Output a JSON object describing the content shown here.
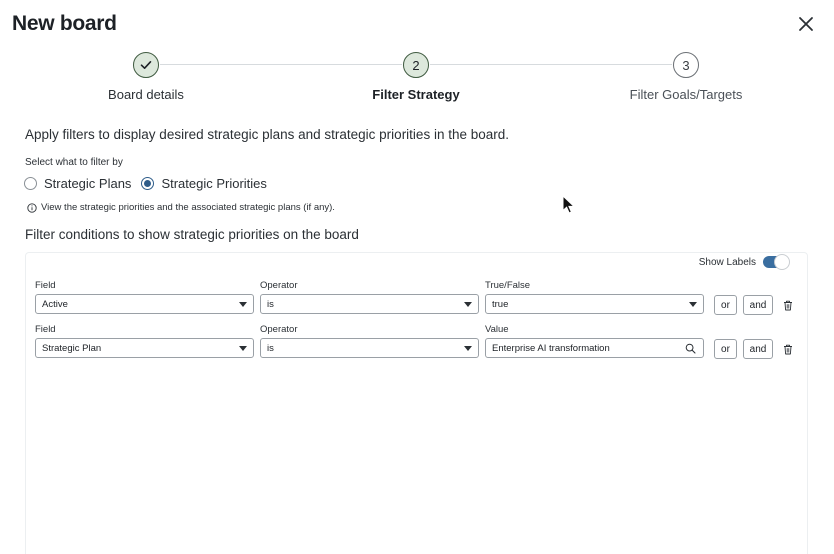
{
  "dialog": {
    "title": "New board"
  },
  "stepper": {
    "steps": [
      {
        "number": "",
        "label": "Board details",
        "state": "done"
      },
      {
        "number": "2",
        "label": "Filter Strategy",
        "state": "active"
      },
      {
        "number": "3",
        "label": "Filter Goals/Targets",
        "state": "todo"
      }
    ]
  },
  "intro": "Apply filters to display desired strategic plans and strategic priorities in the board.",
  "filter_by": {
    "label": "Select what to filter by",
    "options": [
      "Strategic Plans",
      "Strategic Priorities"
    ],
    "selected": "Strategic Priorities"
  },
  "info_text": "View the strategic priorities and the associated strategic plans (if any).",
  "conditions": {
    "title": "Filter conditions to show strategic priorities on the board",
    "show_labels": "Show Labels",
    "show_labels_on": true,
    "rows": [
      {
        "field_label": "Field",
        "field_value": "Active",
        "operator_label": "Operator",
        "operator_value": "is",
        "value_label": "True/False",
        "value": "true",
        "value_type": "select",
        "or": "or",
        "and": "and"
      },
      {
        "field_label": "Field",
        "field_value": "Strategic Plan",
        "operator_label": "Operator",
        "operator_value": "is",
        "value_label": "Value",
        "value": "Enterprise AI transformation",
        "value_type": "search",
        "or": "or",
        "and": "and"
      }
    ]
  },
  "colors": {
    "accent": "#2f5d8a",
    "toggle": "#3a6ea0",
    "step_fill": "#dde8dc",
    "step_border": "#3f5a40"
  }
}
